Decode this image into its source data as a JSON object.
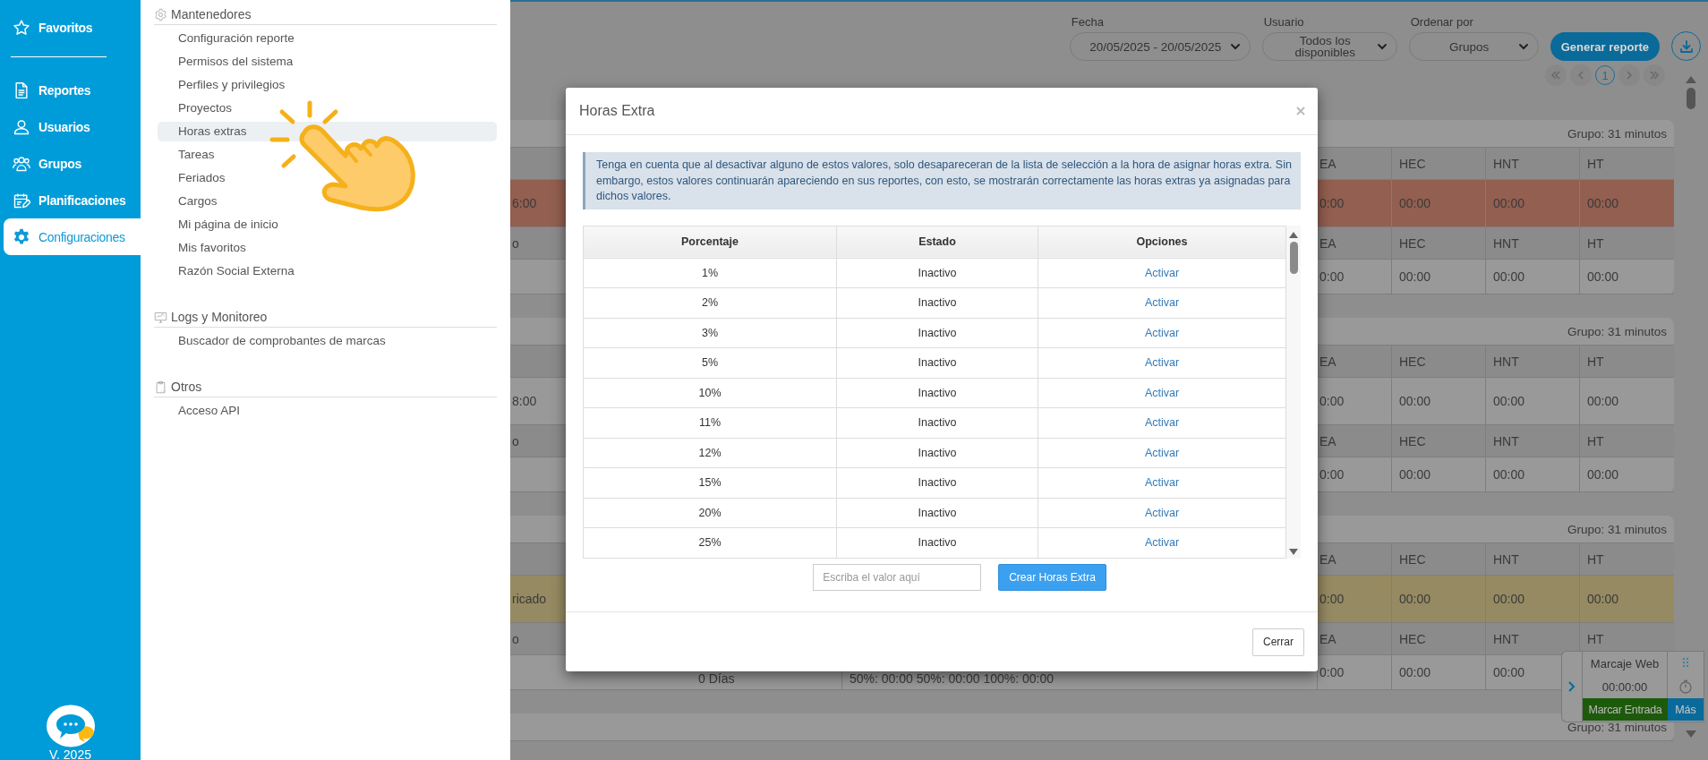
{
  "sidebar": {
    "favorites": {
      "label": "Favoritos",
      "selected": false
    },
    "items": [
      {
        "label": "Reportes",
        "selected": false
      },
      {
        "label": "Usuarios",
        "selected": false
      },
      {
        "label": "Grupos",
        "selected": false
      },
      {
        "label": "Planificaciones",
        "selected": false
      },
      {
        "label": "Configuraciones",
        "selected": true
      }
    ],
    "version": "V. 2025"
  },
  "menu": {
    "sections": [
      {
        "title": "Mantenedores",
        "items": [
          {
            "label": "Configuración reporte",
            "selected": false
          },
          {
            "label": "Permisos del sistema",
            "selected": false
          },
          {
            "label": "Perfiles y privilegios",
            "selected": false
          },
          {
            "label": "Proyectos",
            "selected": false
          },
          {
            "label": "Horas extras",
            "selected": true
          },
          {
            "label": "Tareas",
            "selected": false
          },
          {
            "label": "Feriados",
            "selected": false
          },
          {
            "label": "Cargos",
            "selected": false
          },
          {
            "label": "Mi página de inicio",
            "selected": false
          },
          {
            "label": "Mis favoritos",
            "selected": false
          },
          {
            "label": "Razón Social Externa",
            "selected": false
          }
        ]
      },
      {
        "title": "Logs y Monitoreo",
        "items": [
          {
            "label": "Buscador de comprobantes de marcas",
            "selected": false
          }
        ]
      },
      {
        "title": "Otros",
        "items": [
          {
            "label": "Acceso API",
            "selected": false
          }
        ]
      }
    ]
  },
  "filters": [
    {
      "label": "Fecha",
      "value": "20/05/2025 - 20/05/2025"
    },
    {
      "label": "Usuario",
      "value": "Todos los disponibles"
    },
    {
      "label": "Ordenar por",
      "value": "Grupos"
    }
  ],
  "generate_button": "Generar reporte",
  "pagination": {
    "pages": [
      {
        "label": "1",
        "selected": true
      }
    ]
  },
  "groups": [
    {
      "summary": "Grupo: 31 minutos",
      "rows": [
        {
          "kind": "header",
          "cells": [
            "EA",
            "HEC",
            "HNT",
            "HT"
          ]
        },
        {
          "kind": "data",
          "lead": "6:00",
          "color": "#935f50",
          "cells": [
            "0:00",
            "00:00",
            "00:00",
            "00:00"
          ]
        },
        {
          "kind": "header",
          "lead": "o",
          "cells": [
            "EA",
            "HEC",
            "HNT",
            "HT"
          ]
        },
        {
          "kind": "data",
          "cells": [
            "0:00",
            "00:00",
            "00:00",
            "00:00"
          ]
        }
      ]
    },
    {
      "summary": "Grupo: 31 minutos",
      "rows": [
        {
          "kind": "header",
          "cells": [
            "EA",
            "HEC",
            "HNT",
            "HT"
          ]
        },
        {
          "kind": "data",
          "lead": "8:00",
          "color": "#999999",
          "cells": [
            "0:00",
            "00:00",
            "00:00",
            "00:00"
          ]
        },
        {
          "kind": "header",
          "lead": "o",
          "cells": [
            "EA",
            "HEC",
            "HNT",
            "HT"
          ]
        },
        {
          "kind": "data",
          "cells": [
            "0:00",
            "00:00",
            "00:00",
            "00:00"
          ]
        }
      ]
    },
    {
      "summary": "Grupo: 31 minutos",
      "rows": [
        {
          "kind": "header",
          "cells": [
            "EA",
            "HEC",
            "HNT",
            "HT"
          ]
        },
        {
          "kind": "data",
          "lead": "ricado",
          "color": "#968a62",
          "cells": [
            "0:00",
            "00:00",
            "00:00",
            "00:00"
          ]
        },
        {
          "kind": "header",
          "lead": "o",
          "cells": [
            "EA",
            "HEC",
            "HNT",
            "HT"
          ]
        },
        {
          "kind": "data",
          "col_2": "0 Días",
          "col_3": "50%: 00:00 50%: 00:00 100%: 00:00",
          "cells": [
            "0:00",
            "00:00",
            "00:00"
          ]
        }
      ]
    },
    {
      "summary": "Grupo: 31 minutos"
    }
  ],
  "dialog": {
    "title": "Horas Extra",
    "notice": "Tenga en cuenta que al desactivar alguno de estos valores, solo desapareceran de la lista de selección a la hora de asignar horas extra. Sin embargo, estos valores continuarán apareciendo en sus reportes, con esto, se mostrarán correctamente las horas extras ya asignadas para dichos valores.",
    "columns": [
      "Porcentaje",
      "Estado",
      "Opciones"
    ],
    "rows": [
      {
        "percent": "1%",
        "status": "Inactivo",
        "action": "Activar"
      },
      {
        "percent": "2%",
        "status": "Inactivo",
        "action": "Activar"
      },
      {
        "percent": "3%",
        "status": "Inactivo",
        "action": "Activar"
      },
      {
        "percent": "5%",
        "status": "Inactivo",
        "action": "Activar"
      },
      {
        "percent": "10%",
        "status": "Inactivo",
        "action": "Activar"
      },
      {
        "percent": "11%",
        "status": "Inactivo",
        "action": "Activar"
      },
      {
        "percent": "12%",
        "status": "Inactivo",
        "action": "Activar"
      },
      {
        "percent": "15%",
        "status": "Inactivo",
        "action": "Activar"
      },
      {
        "percent": "20%",
        "status": "Inactivo",
        "action": "Activar"
      },
      {
        "percent": "25%",
        "status": "Inactivo",
        "action": "Activar"
      }
    ],
    "input": {
      "placeholder": "Escriba el valor aquí"
    },
    "create_button": "Crear Horas Extra",
    "close_button": "Cerrar"
  },
  "web_clock": {
    "title": "Marcaje Web",
    "time": "00:00:00",
    "clock_in_button": "Marcar Entrada",
    "more_button": "Más"
  }
}
